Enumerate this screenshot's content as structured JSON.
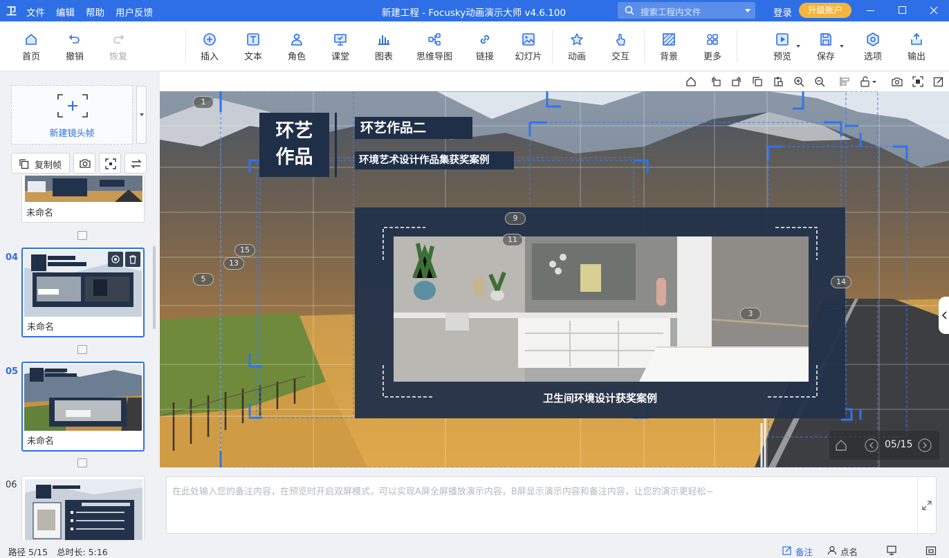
{
  "titlebar": {
    "logo": "卫",
    "menu": [
      "文件",
      "编辑",
      "帮助",
      "用户反馈"
    ],
    "title": "新建工程 - Focusky动画演示大师  v4.6.100",
    "search_placeholder": "搜索工程内文件",
    "login": "登录",
    "upgrade": "升级账户",
    "colors": {
      "bar": "#2e6fe5",
      "upgrade": "#f5b53d"
    }
  },
  "toolbar": {
    "home": "首页",
    "undo": "撤销",
    "redo": "恢复",
    "insert": "插入",
    "text": "文本",
    "role": "角色",
    "classroom": "课堂",
    "chart": "图表",
    "mindmap": "思维导图",
    "link": "链接",
    "slides": "幻灯片",
    "animation": "动画",
    "interact": "交互",
    "background": "背景",
    "more": "更多",
    "preview": "预览",
    "save": "保存",
    "options": "选项",
    "export": "输出"
  },
  "sidebar": {
    "new_frame": "新建镜头帧",
    "copy_frame": "复制帧",
    "frames": [
      {
        "number": "",
        "name": "未命名",
        "selected": false
      },
      {
        "number": "04",
        "name": "未命名",
        "selected": true
      },
      {
        "number": "05",
        "name": "未命名",
        "selected": true
      },
      {
        "number": "06",
        "name": "",
        "selected": false
      }
    ]
  },
  "slide": {
    "title": "环艺作品",
    "title_line1": "环艺",
    "title_line2": "作品",
    "subtitle1": "环艺作品二",
    "subtitle2": "环境艺术设计作品集获奖案例",
    "caption": "卫生间环境设计获奖案例",
    "frame_markers": [
      "1",
      "15",
      "13",
      "5",
      "9",
      "11",
      "3",
      "14"
    ],
    "page_indicator": "05/15"
  },
  "notes": {
    "placeholder": "在此处输入您的备注内容，在预览时开启双屏模式，可以实现A屏全屏播放演示内容，B屏显示演示内容和备注内容，让您的演示更轻松~"
  },
  "status": {
    "path": "路径 5/15",
    "duration": "总时长: 5:16",
    "notes": "备注",
    "rollcall": "点名"
  }
}
